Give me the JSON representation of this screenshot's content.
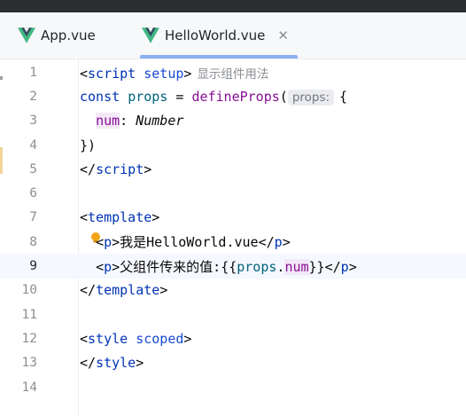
{
  "tabs": [
    {
      "label": "App.vue",
      "icon": "vue-logo-icon",
      "active": false
    },
    {
      "label": "HelloWorld.vue",
      "icon": "vue-logo-icon",
      "active": true
    }
  ],
  "colors": {
    "tag": "#0033b3",
    "function": "#00627a",
    "variable": "#871094",
    "active_tab_underline": "#3574f0",
    "vue_green": "#41b883",
    "vue_dark": "#35495e"
  },
  "editor": {
    "current_line": 9,
    "hint_usage": "显示组件用法",
    "inlay_props": "props:",
    "lines": [
      {
        "n": "1",
        "t": {
          "lt": "<",
          "tag": "script",
          "sp": " ",
          "attr": "setup",
          "gt": ">"
        }
      },
      {
        "n": "2",
        "t": {
          "kw": "const",
          "sp1": " ",
          "var": "props",
          "eq": " = ",
          "fn": "defineProps",
          "op": "(",
          "brace": "{"
        }
      },
      {
        "n": "3",
        "t": {
          "indent": "  ",
          "key": "num",
          "colon": ": ",
          "type": "Number"
        }
      },
      {
        "n": "4",
        "t": {
          "code": "})"
        }
      },
      {
        "n": "5",
        "t": {
          "lt": "</",
          "tag": "script",
          "gt": ">"
        }
      },
      {
        "n": "6",
        "t": {}
      },
      {
        "n": "7",
        "t": {
          "lt": "<",
          "tag": "template",
          "gt": ">"
        }
      },
      {
        "n": "8",
        "t": {
          "indent": "  ",
          "lt": "<",
          "tag": "p",
          "gt": ">",
          "text": "我是HelloWorld.vue",
          "lt2": "</",
          "tag2": "p",
          "gt2": ">"
        }
      },
      {
        "n": "9",
        "t": {
          "indent": "  ",
          "lt": "<",
          "tag": "p",
          "gt": ">",
          "text": "父组件传来的值:{{",
          "obj": "props",
          "dot": ".",
          "key": "num",
          "close": "}}",
          "lt2": "</",
          "tag2": "p",
          "gt2": ">"
        }
      },
      {
        "n": "10",
        "t": {
          "lt": "</",
          "tag": "template",
          "gt": ">"
        }
      },
      {
        "n": "11",
        "t": {}
      },
      {
        "n": "12",
        "t": {
          "lt": "<",
          "tag": "style",
          "sp": " ",
          "attr": "scoped",
          "gt": ">"
        }
      },
      {
        "n": "13",
        "t": {
          "lt": "</",
          "tag": "style",
          "gt": ">"
        }
      },
      {
        "n": "14",
        "t": {}
      }
    ]
  }
}
